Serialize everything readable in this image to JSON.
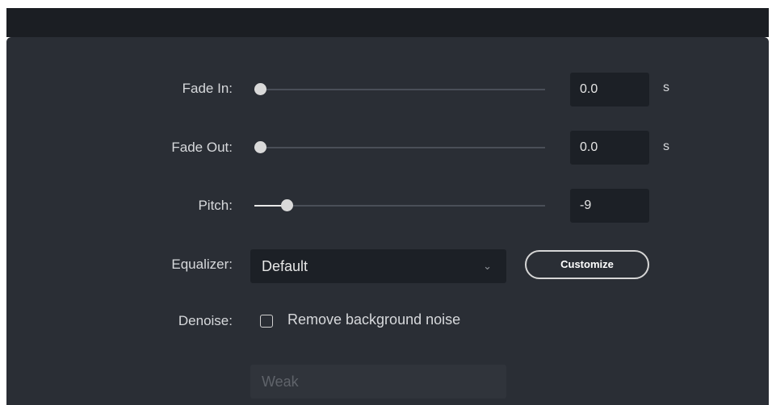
{
  "fade_in": {
    "label": "Fade In:",
    "value": "0.0",
    "unit": "s",
    "slider_fraction": 0.0
  },
  "fade_out": {
    "label": "Fade Out:",
    "value": "0.0",
    "unit": "s",
    "slider_fraction": 0.0
  },
  "pitch": {
    "label": "Pitch:",
    "value": "-9",
    "slider_fraction": 0.1
  },
  "equalizer": {
    "label": "Equalizer:",
    "selected": "Default",
    "customize_label": "Customize"
  },
  "denoise": {
    "label": "Denoise:",
    "checkbox_label": "Remove background noise",
    "checked": false,
    "level": "Weak"
  }
}
